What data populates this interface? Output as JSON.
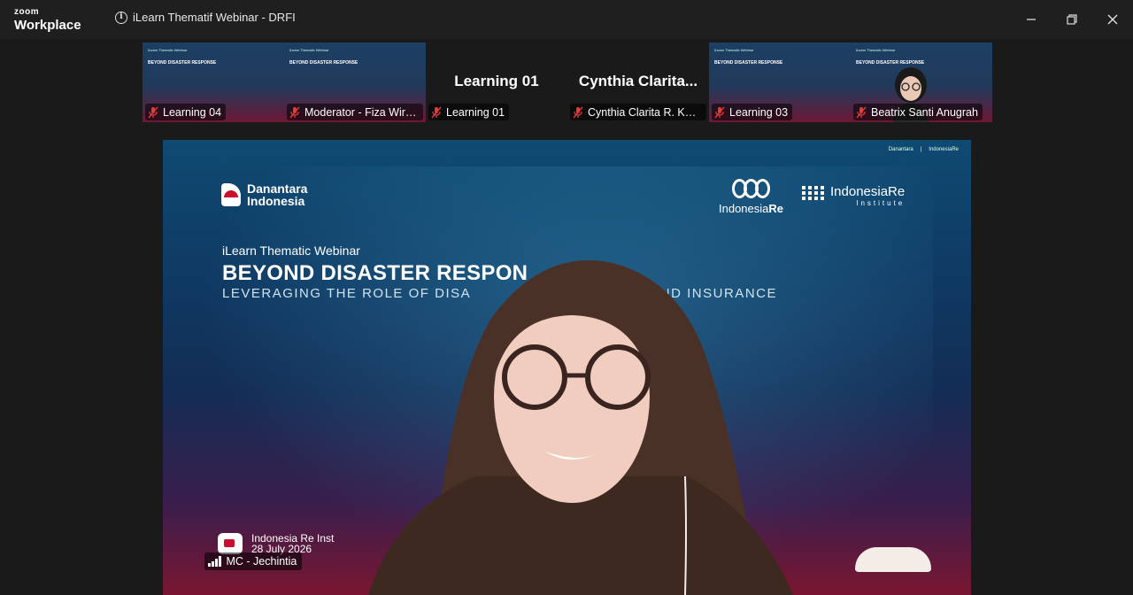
{
  "titlebar": {
    "brand_small": "zoom",
    "brand_large": "Workplace",
    "meeting_title": "iLearn Thematif Webinar - DRFI"
  },
  "thumbnails": [
    {
      "label": "Learning 04",
      "view": "slide",
      "muted": true
    },
    {
      "label": "Moderator - Fiza Wira ...",
      "view": "slide",
      "muted": true
    },
    {
      "label": "Learning 01",
      "view": "name",
      "big_name": "Learning 01",
      "muted": true
    },
    {
      "label": "Cynthia Clarita R. Kush...",
      "view": "name",
      "big_name": "Cynthia  Clarita...",
      "muted": true
    },
    {
      "label": "Learning 03",
      "view": "slide",
      "muted": true
    },
    {
      "label": "Beatrix Santi Anugrah",
      "view": "slide-person",
      "muted": true
    }
  ],
  "main_video": {
    "slide": {
      "danantara_line1": "Danantara",
      "danantara_line2": "Indonesia",
      "indonesia_re": "Indonesia",
      "indonesia_re_bold": "Re",
      "institute_line1": "IndonesiaRe",
      "institute_line2": "Institute",
      "subtitle": "iLearn Thematic Webinar",
      "headline": "BEYOND DISASTER RESPON",
      "tagline_left": "LEVERAGING THE ROLE OF DISA",
      "tagline_right": "ANCING AND INSURANCE",
      "footer_org": "Indonesia Re Inst",
      "footer_date": "28 July 2026"
    },
    "speaker_label": "MC - Jechintia"
  },
  "colors": {
    "titlebar_bg": "#1f1f1f",
    "stage_bg": "#1a1a1a",
    "muted_red": "#e23b3b",
    "slide_blue": "#0f4a72",
    "slide_red": "#7a1631"
  }
}
